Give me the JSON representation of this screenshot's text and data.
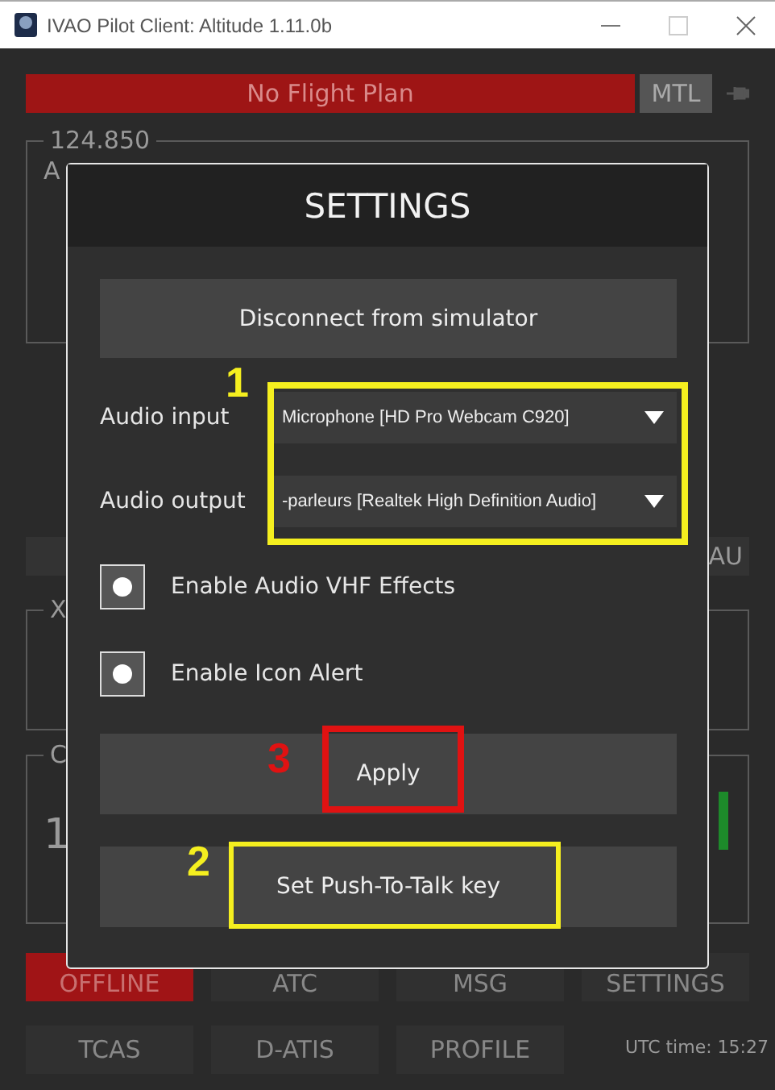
{
  "window": {
    "title": "IVAO Pilot Client: Altitude 1.11.0b"
  },
  "flight_plan": {
    "status": "No Flight Plan",
    "mode_button": "MTL"
  },
  "background": {
    "frequency": "124.850",
    "frequency_text": "A",
    "side_button_text": "AU",
    "group_2_legend": "X",
    "group_3_legend": "C",
    "group_3_value": "1"
  },
  "nav_buttons": [
    {
      "label": "OFFLINE",
      "selected": true
    },
    {
      "label": "ATC",
      "selected": false
    },
    {
      "label": "MSG",
      "selected": false
    },
    {
      "label": "SETTINGS",
      "selected": false
    }
  ],
  "bottom_buttons": [
    "TCAS",
    "D-ATIS",
    "PROFILE"
  ],
  "utc_time": "UTC time: 15:27",
  "dialog": {
    "title": "SETTINGS",
    "disconnect_button": "Disconnect from simulator",
    "fields": [
      {
        "label": "Audio input",
        "value": "Microphone [HD Pro Webcam C920]"
      },
      {
        "label": "Audio output",
        "value": "-parleurs [Realtek High Definition Audio]"
      }
    ],
    "options": [
      {
        "label": "Enable Audio VHF Effects",
        "checked": true
      },
      {
        "label": "Enable Icon Alert",
        "checked": true
      }
    ],
    "apply_button": "Apply",
    "ptt_button": "Set Push-To-Talk key"
  },
  "annotations": [
    {
      "number": "1",
      "color": "#f5ef1f"
    },
    {
      "number": "2",
      "color": "#f5ef1f"
    },
    {
      "number": "3",
      "color": "#e01212"
    }
  ]
}
